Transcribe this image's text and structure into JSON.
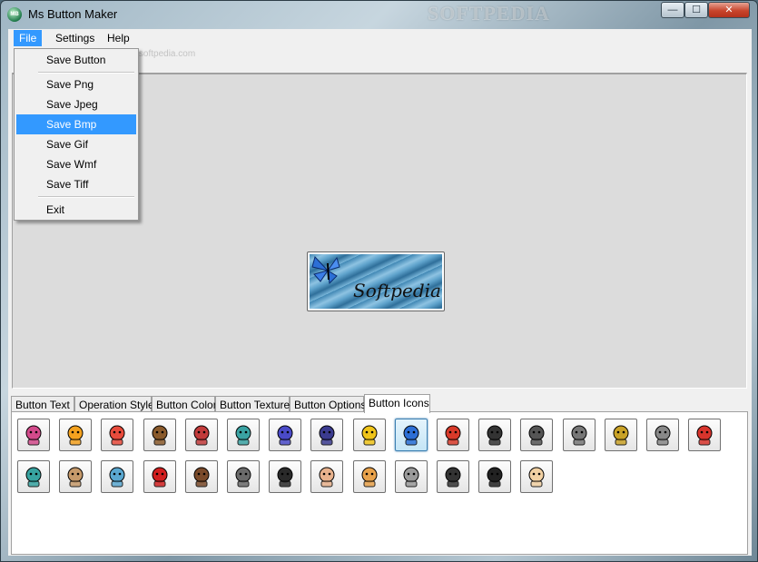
{
  "window": {
    "title": "Ms Button Maker",
    "app_icon_text": "MB",
    "watermark": "SOFTPEDIA",
    "watermark_small": "www.softpedia.com"
  },
  "controls": {
    "minimize": "—",
    "maximize": "☐",
    "close": "✕"
  },
  "menubar": {
    "items": [
      {
        "label": "File"
      },
      {
        "label": "Settings"
      },
      {
        "label": "Help"
      }
    ]
  },
  "file_menu": {
    "items": [
      "Save Button",
      "Save Png",
      "Save Jpeg",
      "Save Bmp",
      "Save Gif",
      "Save Wmf",
      "Save Tiff",
      "Exit"
    ],
    "highlighted": "Save Bmp"
  },
  "preview": {
    "text": "Softpedia"
  },
  "tabs": [
    {
      "label": "Button Text"
    },
    {
      "label": "Operation Style"
    },
    {
      "label": "Button Color"
    },
    {
      "label": "Button Texture"
    },
    {
      "label": "Button Options"
    },
    {
      "label": "Button Icons"
    }
  ],
  "active_tab": "Button Icons",
  "icons": [
    "mouse-character-icon",
    "hot-air-balloon-icon",
    "balloons-icon",
    "deer-icon",
    "notepad-pencil-icon",
    "bird-icon",
    "spider-icon",
    "ant-icon",
    "bee-icon",
    "butterfly-blue-icon",
    "butterfly-red-icon",
    "camera-icon",
    "movie-camera-icon",
    "video-camera-icon",
    "money-icon",
    "cat-icon",
    "palette-icon",
    "dinosaur-icon",
    "dog-icon",
    "horse-icon",
    "ladybug-icon",
    "girl-face-icon",
    "squirrel-icon",
    "woman-face-icon",
    "old-man-face-icon",
    "cat-face-icon",
    "cartoon-cat-icon",
    "man-face-icon",
    "mouse-face-icon",
    "boy-face-icon"
  ],
  "selected_icon": "butterfly-blue-icon",
  "colors": {
    "menu_highlight": "#3399ff",
    "canvas": "#dcdcdc",
    "texture_blue": "#5fa3cc"
  }
}
